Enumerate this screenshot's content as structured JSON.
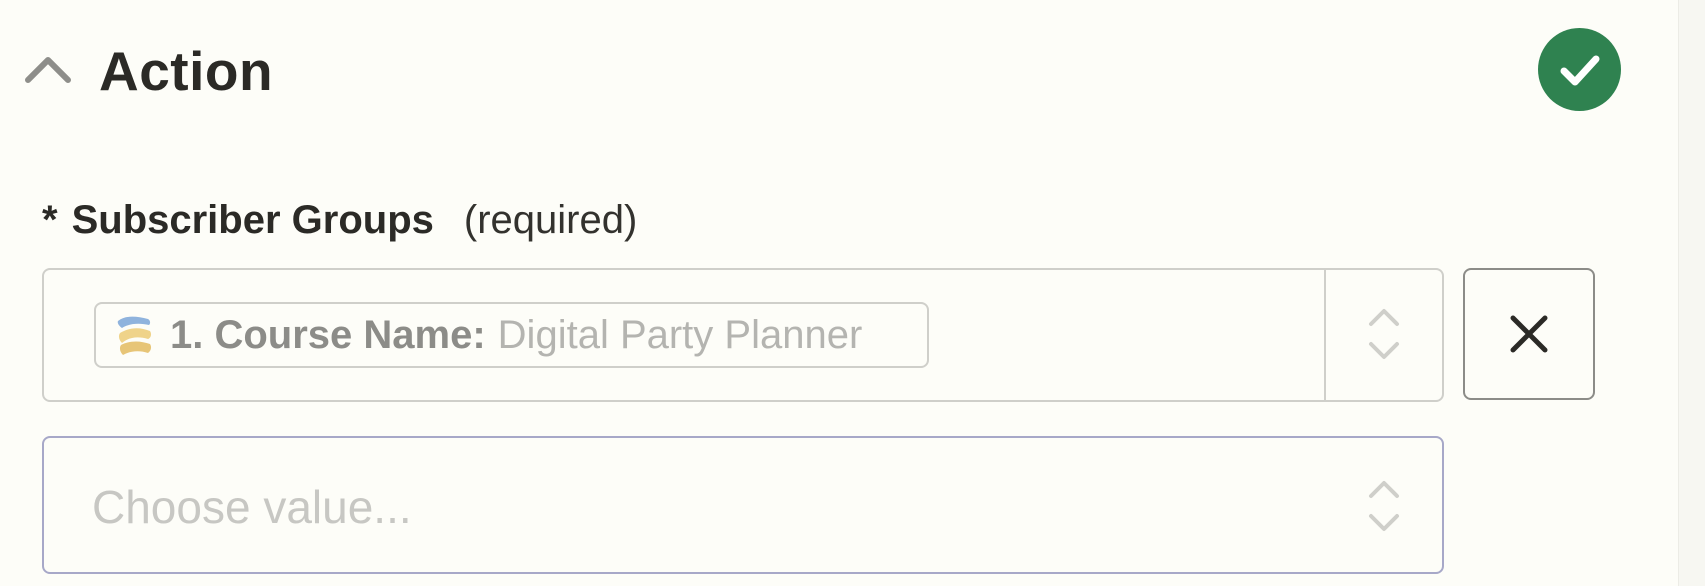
{
  "header": {
    "title": "Action",
    "collapse_icon": "chevron-up-icon",
    "status_icon": "check-circle-icon",
    "status_color": "#2f8250"
  },
  "field": {
    "required_marker": "*",
    "label": "Subscriber Groups",
    "required_hint": "(required)",
    "mapped_value": {
      "app_icon": "app-logo-icon",
      "step_label": "1. Course Name:",
      "value": "Digital Party Planner"
    },
    "dropdown_icon": "up-down-chevron-icon",
    "remove_icon": "close-icon"
  },
  "additional_field": {
    "placeholder": "Choose value..."
  }
}
